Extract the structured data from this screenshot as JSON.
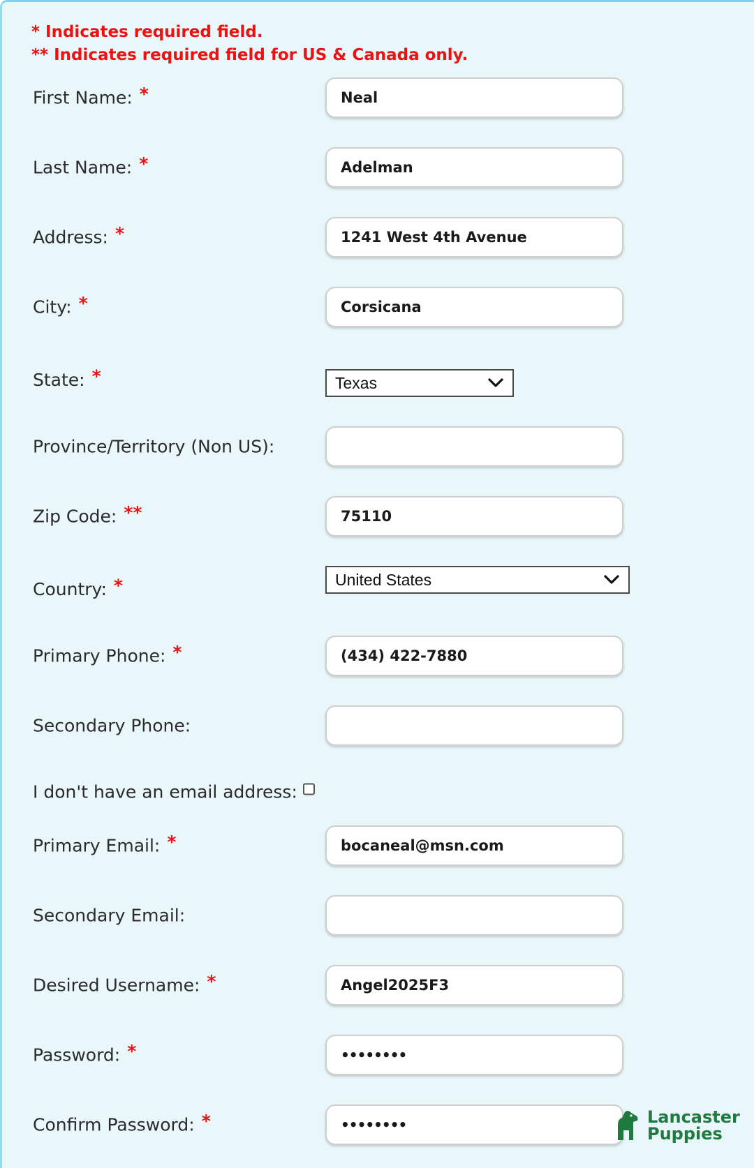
{
  "notes": {
    "required": "* Indicates required field.",
    "required_us_canada": "** Indicates required field for US & Canada only."
  },
  "required_marker": "*",
  "required_us_marker": "**",
  "fields": {
    "first_name": {
      "label": "First Name:",
      "value": "Neal"
    },
    "last_name": {
      "label": "Last Name:",
      "value": "Adelman"
    },
    "address": {
      "label": "Address:",
      "value": "1241 West 4th Avenue"
    },
    "city": {
      "label": "City:",
      "value": "Corsicana"
    },
    "state": {
      "label": "State:",
      "value": "Texas"
    },
    "province": {
      "label": "Province/Territory (Non US):",
      "value": ""
    },
    "zip": {
      "label": "Zip Code:",
      "value": "75110"
    },
    "country": {
      "label": "Country:",
      "value": "United States"
    },
    "primary_phone": {
      "label": "Primary Phone:",
      "value": "(434) 422-7880"
    },
    "secondary_phone": {
      "label": "Secondary Phone:",
      "value": ""
    },
    "no_email": {
      "label": "I don't have an email address:",
      "checked": false
    },
    "primary_email": {
      "label": "Primary Email:",
      "value": "bocaneal@msn.com"
    },
    "secondary_email": {
      "label": "Secondary Email:",
      "value": ""
    },
    "username": {
      "label": "Desired Username:",
      "value": "Angel2025F3"
    },
    "password": {
      "label": "Password:",
      "value": "••••••••"
    },
    "confirm_password": {
      "label": "Confirm Password:",
      "value": "••••••••"
    }
  },
  "logo": {
    "line1": "Lancaster",
    "line2": "Puppies",
    "brand_color": "#1f7a3f"
  },
  "colors": {
    "background": "#e9f7fb",
    "required": "#ee1111",
    "label_text": "#2b2b2b"
  }
}
